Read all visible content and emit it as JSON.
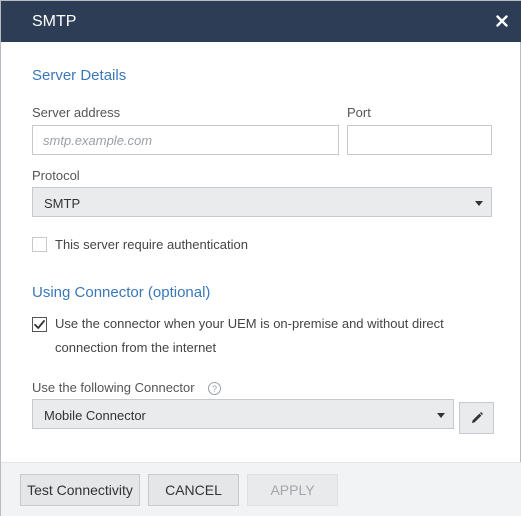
{
  "dialog": {
    "title": "SMTP",
    "close_icon": "close-icon"
  },
  "server_details": {
    "section_title": "Server Details",
    "server_address": {
      "label": "Server address",
      "placeholder": "smtp.example.com",
      "value": ""
    },
    "port": {
      "label": "Port",
      "value": ""
    },
    "protocol": {
      "label": "Protocol",
      "selected": "SMTP"
    },
    "auth": {
      "label": "This server require authentication",
      "checked": false
    }
  },
  "connector": {
    "section_title": "Using Connector (optional)",
    "use_connector": {
      "line1": "Use the connector when your UEM is on-premise and without direct",
      "line2": "connection from the internet",
      "checked": true
    },
    "following_label": "Use the following Connector",
    "help_icon": "question-circle-icon",
    "selected": "Mobile Connector",
    "edit_icon": "pencil-icon"
  },
  "footer": {
    "test_label": "Test Connectivity",
    "cancel_label": "CANCEL",
    "apply_label": "APPLY",
    "apply_disabled": true
  },
  "colors": {
    "titlebar": "#2c3d55",
    "section_title": "#3a78b9",
    "footer_bg": "#f2f3f4"
  }
}
